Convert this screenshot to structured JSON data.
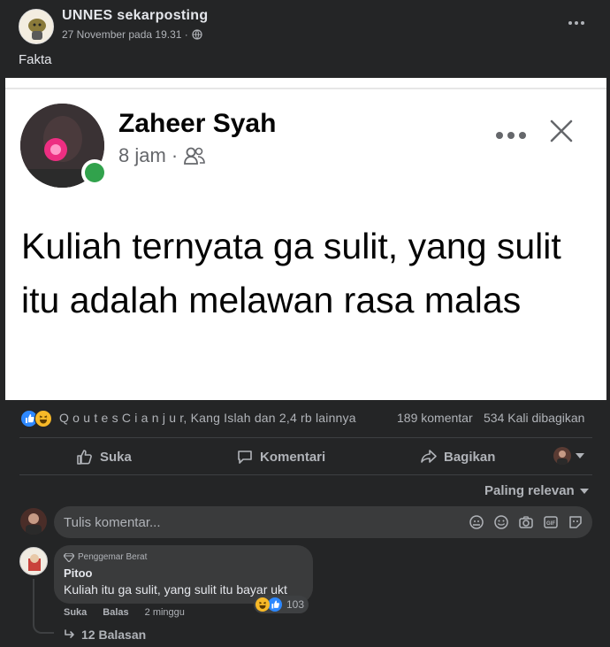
{
  "post": {
    "page_name": "UNNES sekarposting",
    "timestamp": "27 November pada 19.31 ·",
    "caption": "Fakta"
  },
  "embedded": {
    "author": "Zaheer Syah",
    "time": "8 jam ·",
    "text": "Kuliah ternyata ga sulit, yang sulit itu adalah melawan rasa malas"
  },
  "reactions": {
    "summary": "Q o u t e s C i a n j u r, Kang Islah dan 2,4 rb lainnya",
    "comments_count": "189 komentar",
    "shares_count": "534 Kali dibagikan"
  },
  "actions": {
    "like": "Suka",
    "comment": "Komentari",
    "share": "Bagikan"
  },
  "sort": {
    "label": "Paling relevan"
  },
  "composer": {
    "placeholder": "Tulis komentar..."
  },
  "comment": {
    "badge": "Penggemar Berat",
    "author": "Pitoo",
    "text": "Kuliah itu ga sulit, yang sulit itu bayar ukt",
    "like": "Suka",
    "reply": "Balas",
    "time": "2 minggu",
    "reaction_count": "103",
    "replies": "12 Balasan"
  },
  "colors": {
    "bg": "#242526",
    "accent_blue": "#2d88ff",
    "online_green": "#31a24c"
  }
}
